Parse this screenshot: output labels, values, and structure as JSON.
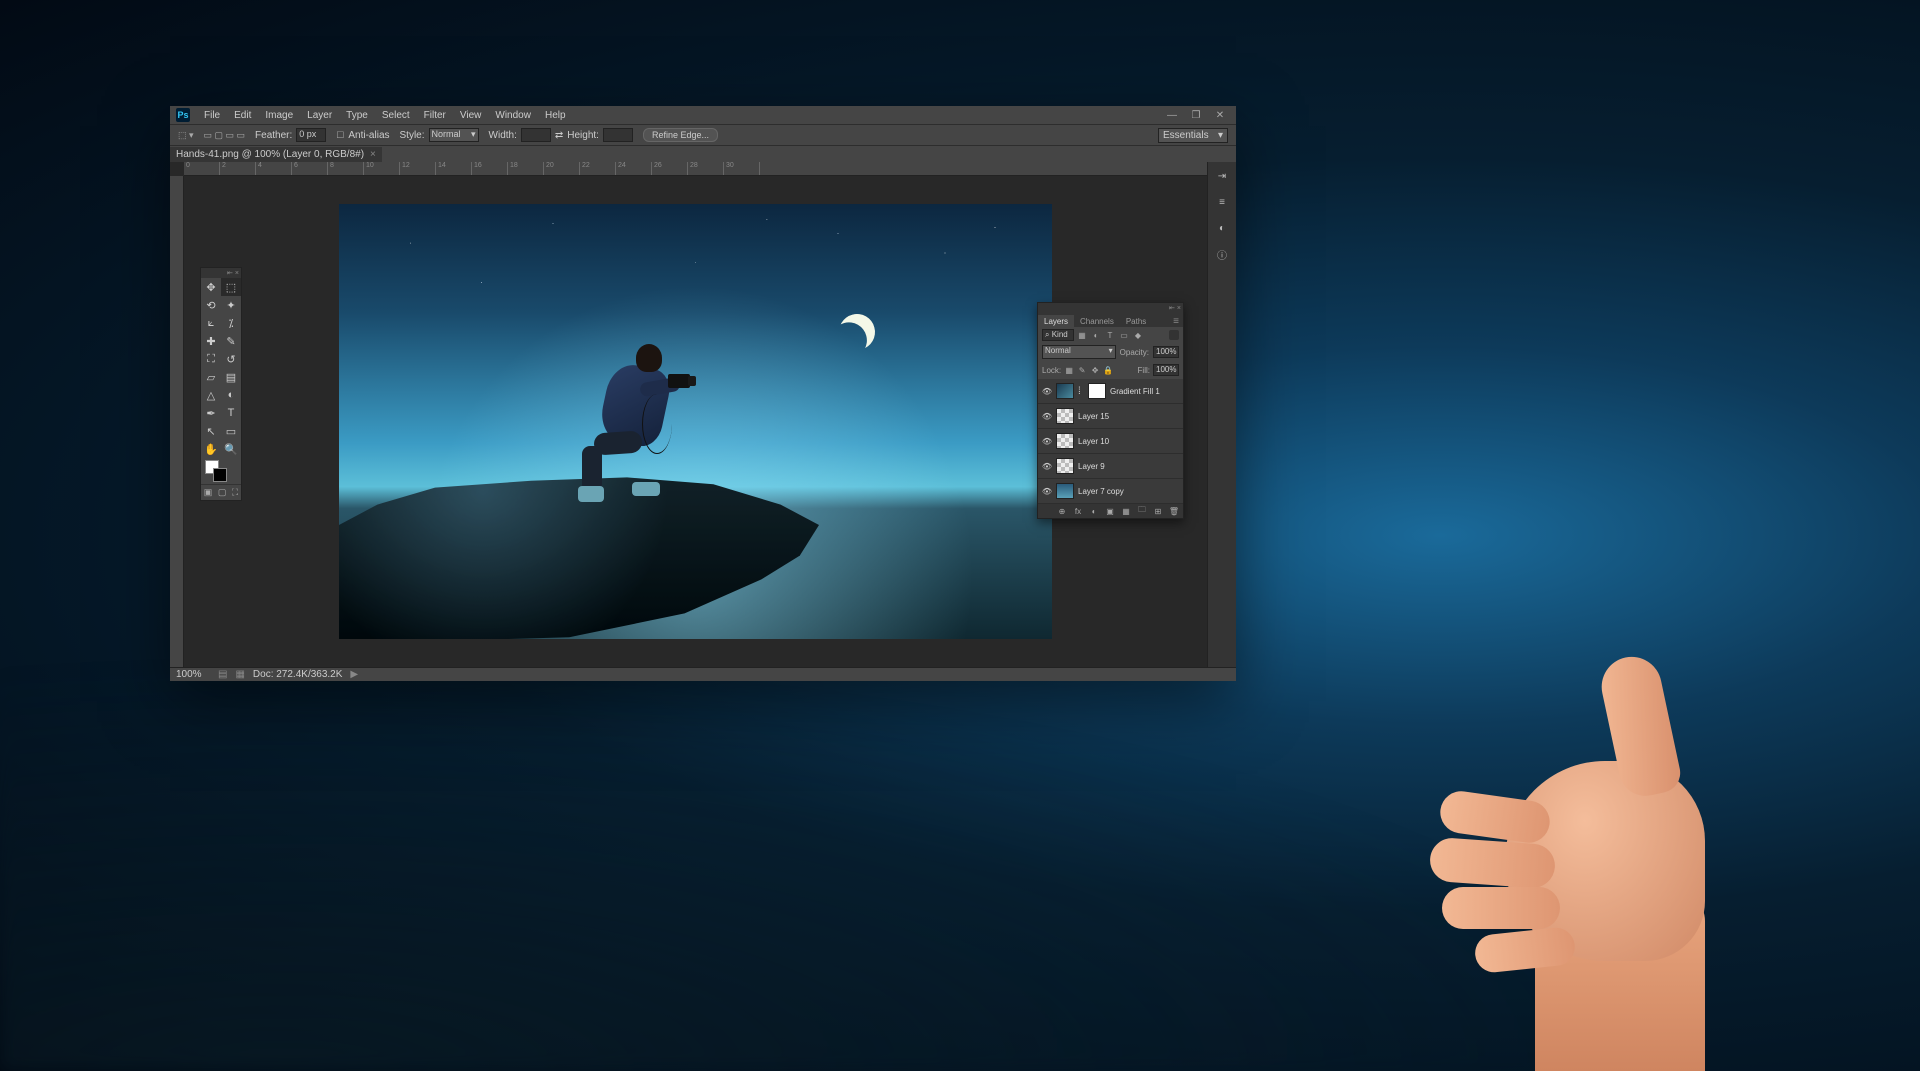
{
  "app": {
    "logo": "Ps"
  },
  "menubar": [
    "File",
    "Edit",
    "Image",
    "Layer",
    "Type",
    "Select",
    "Filter",
    "View",
    "Window",
    "Help"
  ],
  "window_controls": {
    "minimize": "—",
    "maximize": "❐",
    "close": "✕"
  },
  "optionsbar": {
    "feather_label": "Feather:",
    "feather_value": "0 px",
    "antialias": "Anti-alias",
    "style_label": "Style:",
    "style_value": "Normal",
    "width_label": "Width:",
    "height_label": "Height:",
    "refine": "Refine Edge..."
  },
  "workspace": "Essentials",
  "document": {
    "tab": "Hands-41.png @ 100% (Layer 0, RGB/8#)"
  },
  "ruler_ticks": [
    "0",
    "2",
    "4",
    "6",
    "8",
    "10",
    "12",
    "14",
    "16",
    "18",
    "20",
    "22",
    "24",
    "26",
    "28",
    "30"
  ],
  "tools_panel": {
    "controls": {
      "collapse": "⇤",
      "close": "×"
    }
  },
  "tools": [
    {
      "name": "move-tool",
      "glyph": "✥"
    },
    {
      "name": "marquee-tool",
      "glyph": "⬚",
      "sel": true
    },
    {
      "name": "lasso-tool",
      "glyph": "⟲"
    },
    {
      "name": "wand-tool",
      "glyph": "✦"
    },
    {
      "name": "crop-tool",
      "glyph": "⟀"
    },
    {
      "name": "eyedropper-tool",
      "glyph": "⁒"
    },
    {
      "name": "healing-tool",
      "glyph": "✚"
    },
    {
      "name": "brush-tool",
      "glyph": "✎"
    },
    {
      "name": "stamp-tool",
      "glyph": "⛶"
    },
    {
      "name": "history-brush-tool",
      "glyph": "↺"
    },
    {
      "name": "eraser-tool",
      "glyph": "▱"
    },
    {
      "name": "gradient-tool",
      "glyph": "▤"
    },
    {
      "name": "blur-tool",
      "glyph": "△"
    },
    {
      "name": "dodge-tool",
      "glyph": "◐"
    },
    {
      "name": "pen-tool",
      "glyph": "✒"
    },
    {
      "name": "type-tool",
      "glyph": "T"
    },
    {
      "name": "path-tool",
      "glyph": "↖"
    },
    {
      "name": "shape-tool",
      "glyph": "▭"
    },
    {
      "name": "hand-tool",
      "glyph": "✋"
    },
    {
      "name": "zoom-tool",
      "glyph": "🔍"
    }
  ],
  "quickmask": [
    "▣",
    "▢",
    "⛶"
  ],
  "right_strip": [
    {
      "name": "expand-icon",
      "glyph": "⇥"
    },
    {
      "name": "history-icon",
      "glyph": "≡"
    },
    {
      "name": "adjustments-icon",
      "glyph": "◐"
    },
    {
      "name": "info-icon",
      "glyph": "ⓘ"
    }
  ],
  "layers_panel": {
    "controls": {
      "collapse": "⇤",
      "close": "×",
      "menu": "≡"
    },
    "tabs": [
      "Layers",
      "Channels",
      "Paths"
    ],
    "filter": {
      "kind_label": "⌕ Kind",
      "icons": [
        "▦",
        "◐",
        "T",
        "▭",
        "◆"
      ]
    },
    "blend": {
      "mode": "Normal",
      "opacity_label": "Opacity:",
      "opacity": "100%",
      "fill_label": "Fill:",
      "fill": "100%"
    },
    "lock": {
      "label": "Lock:",
      "icons": [
        "▦",
        "✎",
        "✥",
        "🔒"
      ]
    },
    "layers": [
      {
        "name": "Gradient Fill 1",
        "thumbs": [
          "grad",
          "white"
        ],
        "link": true
      },
      {
        "name": "Layer 15",
        "thumbs": [
          "checker"
        ]
      },
      {
        "name": "Layer 10",
        "thumbs": [
          "checker"
        ]
      },
      {
        "name": "Layer 9",
        "thumbs": [
          "checker"
        ]
      },
      {
        "name": "Layer 7 copy",
        "thumbs": [
          "img"
        ]
      }
    ],
    "footer_icons": [
      "⊕",
      "fx",
      "◐",
      "▣",
      "▦",
      "🗀",
      "⊞",
      "🗑"
    ]
  },
  "statusbar": {
    "zoom": "100%",
    "doc": "Doc: 272.4K/363.2K",
    "arrow": "▶"
  }
}
